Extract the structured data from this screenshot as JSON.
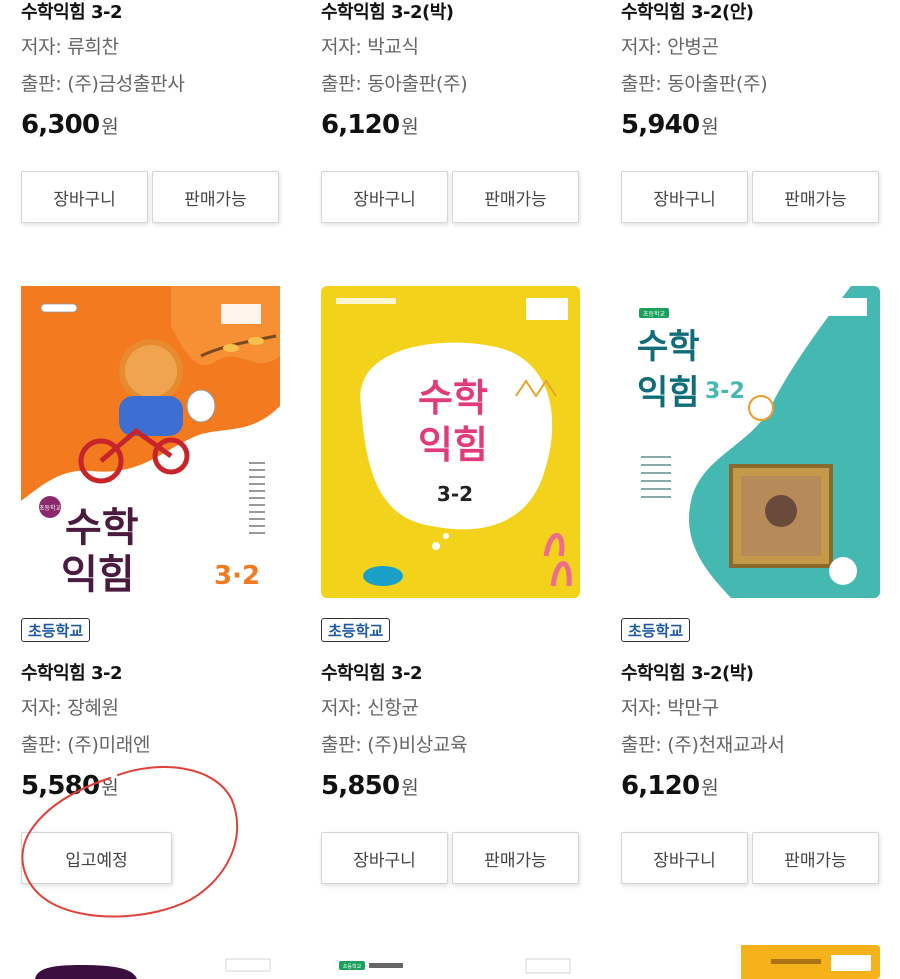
{
  "top_row": [
    {
      "title": "수학익힘 3-2",
      "author": "저자: 류희찬",
      "publisher": "출판: (주)금성출판사",
      "price": "6,300",
      "currency": "원",
      "cart_label": "장바구니",
      "status_label": "판매가능"
    },
    {
      "title": "수학익힘 3-2(박)",
      "author": "저자: 박교식",
      "publisher": "출판: 동아출판(주)",
      "price": "6,120",
      "currency": "원",
      "cart_label": "장바구니",
      "status_label": "판매가능"
    },
    {
      "title": "수학익힘 3-2(안)",
      "author": "저자: 안병곤",
      "publisher": "출판: 동아출판(주)",
      "price": "5,940",
      "currency": "원",
      "cart_label": "장바구니",
      "status_label": "판매가능"
    }
  ],
  "middle_row": [
    {
      "badge": "초등학교",
      "title": "수학익힘 3-2",
      "author": "저자: 장혜원",
      "publisher": "출판: (주)미래엔",
      "price": "5,580",
      "currency": "원",
      "action_label": "입고예정",
      "cover": {
        "school": "초등학교",
        "title_a": "수학",
        "title_b": "익힘",
        "grade": "3·2",
        "bg": "#f47a20"
      }
    },
    {
      "badge": "초등학교",
      "title": "수학익힘 3-2",
      "author": "저자: 신항균",
      "publisher": "출판: (주)비상교육",
      "price": "5,850",
      "currency": "원",
      "cart_label": "장바구니",
      "status_label": "판매가능",
      "cover": {
        "title_a": "수학",
        "title_b": "익힘",
        "grade": "3-2",
        "bg": "#f3d21c"
      }
    },
    {
      "badge": "초등학교",
      "title": "수학익힘 3-2(박)",
      "author": "저자: 박만구",
      "publisher": "출판: (주)천재교과서",
      "price": "6,120",
      "currency": "원",
      "cart_label": "장바구니",
      "status_label": "판매가능",
      "cover": {
        "school": "초등학교",
        "title_a": "수학",
        "title_b": "익힘",
        "grade": "3-2",
        "bg": "#46b8b2"
      }
    }
  ],
  "bottom_row_peek": [
    {
      "bg": "#ffffff"
    },
    {
      "bg": "#ffffff",
      "school": "초등학교"
    },
    {
      "bg": "#f6b21a"
    }
  ],
  "colors": {
    "annotation": "#e0413a",
    "badge_text": "#1f5aa6"
  }
}
